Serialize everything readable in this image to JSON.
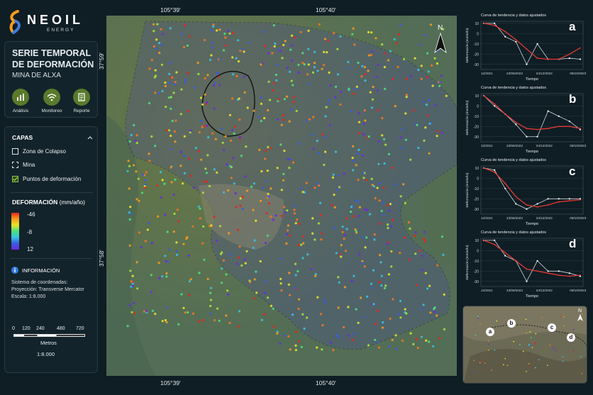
{
  "brand": {
    "name": "NEOIL",
    "tagline": "ENERGY"
  },
  "title": {
    "line1": "SERIE TEMPORAL",
    "line2": "DE DEFORMACIÓN",
    "subtitle": "MINA DE ALXA"
  },
  "tools": [
    {
      "label": "Análisis",
      "icon": "bar-chart-icon"
    },
    {
      "label": "Monitoreo",
      "icon": "wifi-icon"
    },
    {
      "label": "Reporte",
      "icon": "document-icon"
    }
  ],
  "layers": {
    "title": "CAPAS",
    "items": [
      {
        "label": "Zona de Colapso",
        "checked": false
      },
      {
        "label": "Mina",
        "checked": false
      },
      {
        "label": "Puntos de deformación",
        "checked": true
      }
    ]
  },
  "legend": {
    "title": "DEFORMACIÓN",
    "unit": "(mm/año)",
    "max": "-46",
    "mid": "-8",
    "min": "12"
  },
  "info": {
    "title": "INFORMACIÓN",
    "line1": "Sistema de coordenadas:",
    "line2": "Proyección: Transverse Mercator",
    "line3": "Escala: 1:8.000"
  },
  "scalebar": {
    "ticks": [
      "0",
      "120",
      "240",
      "480",
      "720"
    ],
    "unit": "Metros",
    "ratio": "1:8.000"
  },
  "map": {
    "lon_labels": [
      "105°39′",
      "105°40′"
    ],
    "lat_labels": [
      "37°59′",
      "37°58′"
    ],
    "north": "N"
  },
  "charts": [
    {
      "letter": "a",
      "title": "Curva de tendencia y datos ajustados",
      "ylabel": "Deformación (mm/año)",
      "xlabel": "Tiempo",
      "yticks": [
        "10",
        "0",
        "-10",
        "-20",
        "-30"
      ],
      "xticks": [
        "12/2021",
        "23/06/2022",
        "24/12/2022",
        "09/10/2023"
      ],
      "fit": [
        10,
        8,
        2,
        -6,
        -15,
        -24,
        -25,
        -25,
        -20,
        -14
      ],
      "obs": [
        10,
        10,
        -3,
        -8,
        -30,
        -10,
        -25,
        -25,
        -24,
        -25
      ]
    },
    {
      "letter": "b",
      "title": "Curva de tendencia y datos ajustados",
      "ylabel": "Deformación (mm/año)",
      "xlabel": "Tiempo",
      "yticks": [
        "10",
        "0",
        "-10",
        "-20",
        "-30"
      ],
      "xticks": [
        "12/2021",
        "23/06/2022",
        "24/12/2022",
        "09/10/2023"
      ],
      "fit": [
        10,
        2,
        -8,
        -16,
        -22,
        -23,
        -22,
        -20,
        -20,
        -22
      ],
      "obs": [
        10,
        0,
        -8,
        -18,
        -30,
        -30,
        -5,
        -10,
        -15,
        -23
      ]
    },
    {
      "letter": "c",
      "title": "Curva de tendencia y datos ajustados",
      "ylabel": "Deformación (mm/año)",
      "xlabel": "Tiempo",
      "yticks": [
        "10",
        "0",
        "-10",
        "-20",
        "-30"
      ],
      "xticks": [
        "12/2021",
        "23/06/2022",
        "24/12/2022",
        "09/10/2023"
      ],
      "fit": [
        10,
        6,
        -5,
        -18,
        -26,
        -28,
        -26,
        -23,
        -22,
        -21
      ],
      "obs": [
        10,
        8,
        -10,
        -25,
        -30,
        -25,
        -20,
        -20,
        -20,
        -20
      ]
    },
    {
      "letter": "d",
      "title": "Curva de tendencia y datos ajustados",
      "ylabel": "Deformación (mm/año)",
      "xlabel": "Tiempo",
      "yticks": [
        "10",
        "0",
        "-10",
        "-20",
        "-30"
      ],
      "xticks": [
        "12/2021",
        "23/06/2022",
        "24/12/2022",
        "09/10/2023"
      ],
      "fit": [
        10,
        6,
        -2,
        -10,
        -18,
        -20,
        -22,
        -24,
        -25,
        -24
      ],
      "obs": [
        10,
        10,
        -5,
        -10,
        -30,
        -10,
        -20,
        -20,
        -22,
        -25
      ]
    }
  ],
  "minimap": {
    "markers": [
      "a",
      "b",
      "c",
      "d"
    ],
    "north": "N"
  },
  "colors": {
    "fit": "#e53935",
    "obs": "#cfd8dc",
    "accent": "#5a7a2b",
    "panel": "#13232b"
  }
}
